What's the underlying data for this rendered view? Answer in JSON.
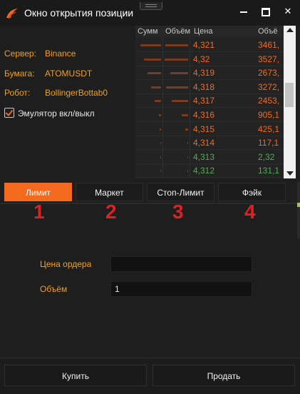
{
  "window": {
    "title": "Окно открытия позиции",
    "accent": "#f36a1e"
  },
  "info": {
    "server_label": "Сервер:",
    "server_value": "Binance",
    "security_label": "Бумага:",
    "security_value": "ATOMUSDT",
    "robot_label": "Робот:",
    "robot_value": "BollingerBottab0",
    "emulator_label": "Эмулятор вкл/выкл",
    "emulator_checked": true
  },
  "orderbook": {
    "headers": {
      "sum": "Сумм",
      "volume": "Объём",
      "price": "Цена",
      "volume2": "Объё"
    },
    "rows": [
      {
        "price": "4,321",
        "volume": "3461,",
        "side": "ask",
        "sum_fill": 0.85,
        "vol_fill": 0.9
      },
      {
        "price": "4,32",
        "volume": "3527,",
        "side": "ask",
        "sum_fill": 0.7,
        "vol_fill": 0.92
      },
      {
        "price": "4,319",
        "volume": "2673,",
        "side": "ask",
        "sum_fill": 0.55,
        "vol_fill": 0.7
      },
      {
        "price": "4,318",
        "volume": "3272,",
        "side": "ask",
        "sum_fill": 0.4,
        "vol_fill": 0.85
      },
      {
        "price": "4,317",
        "volume": "2453,",
        "side": "ask",
        "sum_fill": 0.25,
        "vol_fill": 0.65
      },
      {
        "price": "4,316",
        "volume": "905,1",
        "side": "ask",
        "sum_fill": 0.1,
        "vol_fill": 0.25
      },
      {
        "price": "4,315",
        "volume": "425,1",
        "side": "ask",
        "sum_fill": 0.05,
        "vol_fill": 0.12
      },
      {
        "price": "4,314",
        "volume": "117,1",
        "side": "ask",
        "sum_fill": 0.02,
        "vol_fill": 0.04
      },
      {
        "price": "4,313",
        "volume": "2,32",
        "side": "bid",
        "sum_fill": 0.02,
        "vol_fill": 0.02
      },
      {
        "price": "4,312",
        "volume": "131,1",
        "side": "bid",
        "sum_fill": 0.03,
        "vol_fill": 0.04
      }
    ],
    "ask_color": "#f36a1e",
    "bid_color": "#4caf50",
    "bar_color": "#7a3a1e"
  },
  "tabs": [
    {
      "label": "Лимит",
      "active": true,
      "number": "1"
    },
    {
      "label": "Маркет",
      "active": false,
      "number": "2"
    },
    {
      "label": "Стоп-Лимит",
      "active": false,
      "number": "3"
    },
    {
      "label": "Фэйк",
      "active": false,
      "number": "4"
    }
  ],
  "form": {
    "price_label": "Цена ордера",
    "price_value": "",
    "volume_label": "Объём",
    "volume_value": "1"
  },
  "actions": {
    "buy_label": "Купить",
    "sell_label": "Продать"
  }
}
